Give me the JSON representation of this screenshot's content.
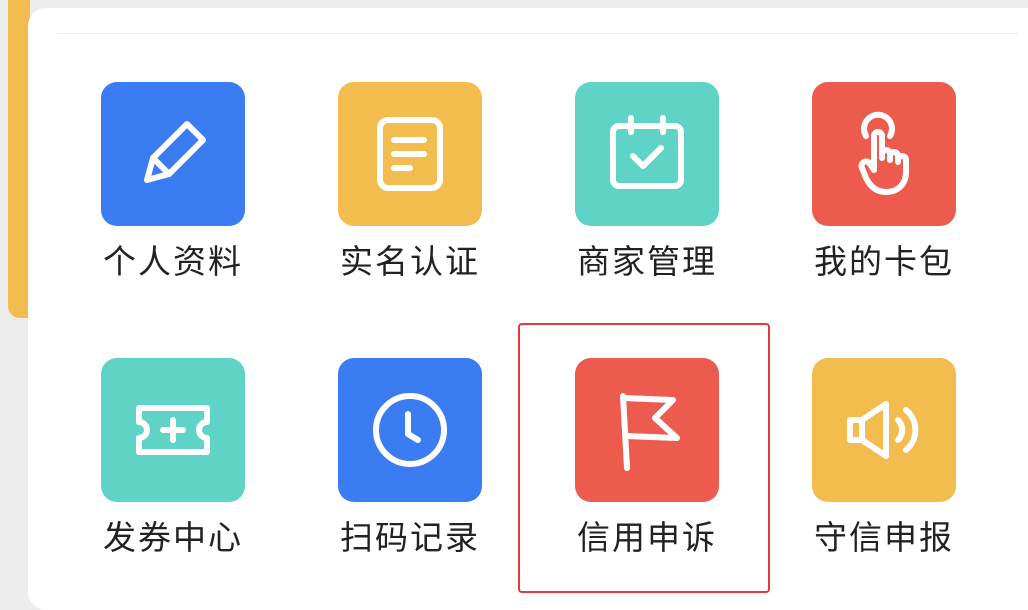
{
  "colors": {
    "blue": "#3b7cf2",
    "yellow": "#f2bd4e",
    "teal": "#5fd3c6",
    "red": "#ec5b4d",
    "highlight": "#e23a3a"
  },
  "menu": {
    "items": [
      {
        "label": "个人资料",
        "icon": "pencil-icon",
        "color": "#3b7cf2"
      },
      {
        "label": "实名认证",
        "icon": "document-icon",
        "color": "#f2bd4e"
      },
      {
        "label": "商家管理",
        "icon": "calendar-check-icon",
        "color": "#5fd3c6"
      },
      {
        "label": "我的卡包",
        "icon": "tap-hand-icon",
        "color": "#ec5b4d"
      },
      {
        "label": "发券中心",
        "icon": "ticket-plus-icon",
        "color": "#5fd3c6"
      },
      {
        "label": "扫码记录",
        "icon": "clock-icon",
        "color": "#3b7cf2"
      },
      {
        "label": "信用申诉",
        "icon": "flag-icon",
        "color": "#ec5b4d"
      },
      {
        "label": "守信申报",
        "icon": "speaker-icon",
        "color": "#f2bd4e"
      }
    ]
  }
}
